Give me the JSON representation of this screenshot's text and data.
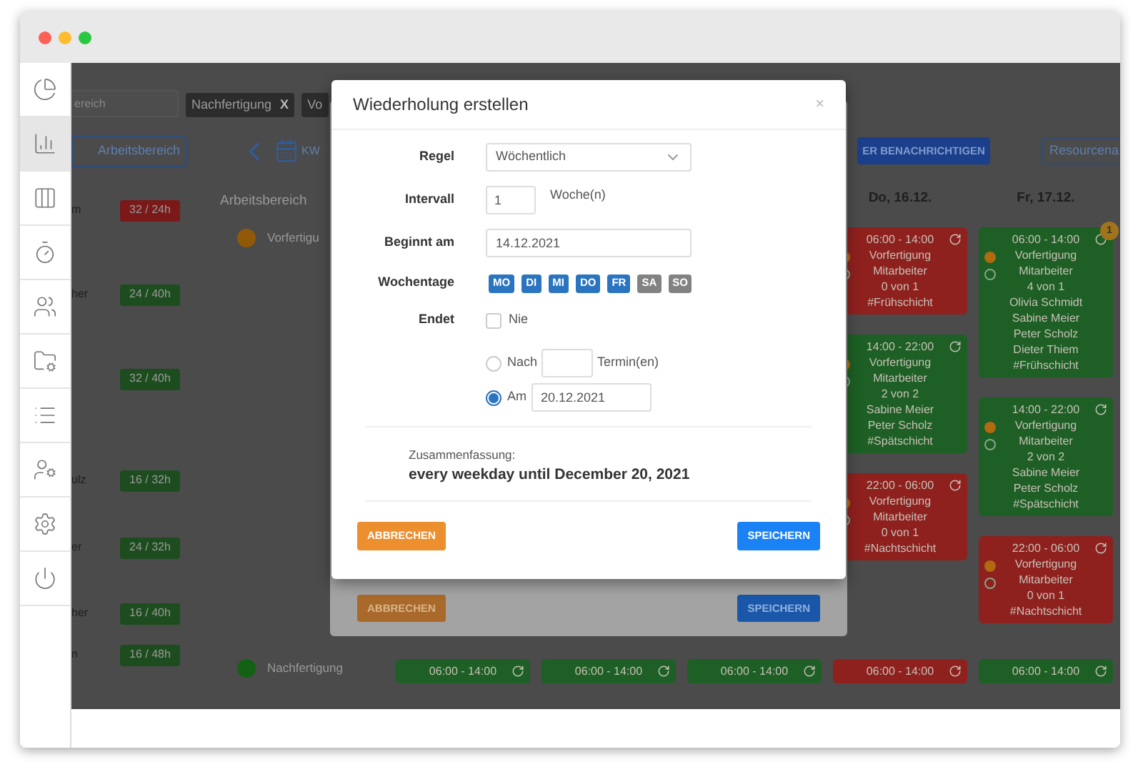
{
  "sidebar": {
    "items": [
      {
        "selected": false
      },
      {
        "selected": true
      },
      {
        "selected": false
      },
      {
        "selected": false
      },
      {
        "selected": false
      },
      {
        "selected": false
      },
      {
        "selected": false
      },
      {
        "selected": false
      },
      {
        "selected": false
      },
      {
        "selected": false
      }
    ]
  },
  "filter": {
    "search": {
      "placeholder": "ereich"
    },
    "tags": [
      {
        "label": "Nachfertigung",
        "remove": "X"
      },
      {
        "label": "Vo"
      }
    ]
  },
  "toolbar": {
    "group_button": "Arbeitsbereich",
    "week": "KW",
    "notify_button": "ER BENACHRICHTIGEN",
    "resource_button": "Resourcena"
  },
  "employees": [
    {
      "name": "m",
      "hours": "32 / 24h",
      "color": "#7b1919"
    },
    {
      "name": "her",
      "hours": "24 / 40h",
      "color": "#1d4d1f"
    },
    {
      "hours": "32 / 40h",
      "color": "#1d4d1f"
    },
    {
      "name": "ulz",
      "hours": "16 / 32h",
      "color": "#1d4d1f"
    },
    {
      "name": "er",
      "hours": "24 / 32h",
      "color": "#1d4d1f"
    },
    {
      "name": "her",
      "hours": "16 / 40h",
      "color": "#1d4d1f"
    },
    {
      "name": "n",
      "hours": "16 / 48h",
      "color": "#1d4d1f"
    }
  ],
  "areas": {
    "header": "Arbeitsbereich",
    "items": [
      {
        "name": "Vorfertigu",
        "color": "#905908"
      },
      {
        "name": "Nachfertigung",
        "color": "#136213"
      }
    ]
  },
  "days": [
    {
      "later_shifts": [
        {
          "lines": [
            "06:00 - 14:00"
          ],
          "color": "#1d5f24"
        }
      ]
    },
    {
      "later_shifts": [
        {
          "lines": [
            "06:00 - 14:00"
          ],
          "color": "#1d5f24"
        }
      ]
    },
    {
      "later_shifts": [
        {
          "lines": [
            "06:00 - 14:00"
          ],
          "color": "#1d5f24"
        }
      ]
    },
    {
      "header": "Do, 16.12.",
      "shifts": [
        {
          "lines": [
            "06:00 - 14:00",
            "Vorfertigung",
            "Mitarbeiter",
            "0 von 1",
            "#Frühschicht"
          ],
          "color": "#8e211e"
        },
        {
          "lines": [
            "14:00 - 22:00",
            "Vorfertigung",
            "Mitarbeiter",
            "2 von 2",
            "Sabine Meier",
            "Peter Scholz",
            "#Spätschicht"
          ],
          "color": "#1d5f24"
        },
        {
          "lines": [
            "22:00 - 06:00",
            "Vorfertigung",
            "Mitarbeiter",
            "0 von 1",
            "#Nachtschicht"
          ],
          "color": "#8e211e"
        }
      ],
      "later_shifts": [
        {
          "lines": [
            "06:00 - 14:00"
          ],
          "color": "#8e211e"
        }
      ]
    },
    {
      "header": "Fr, 17.12.",
      "shifts": [
        {
          "lines": [
            "06:00 - 14:00",
            "Vorfertigung",
            "Mitarbeiter",
            "4 von 1",
            "Olivia Schmidt",
            "Sabine Meier",
            "Peter Scholz",
            "Dieter Thiem",
            "#Frühschicht"
          ],
          "color": "#1d5f24",
          "badge": "1"
        },
        {
          "lines": [
            "14:00 - 22:00",
            "Vorfertigung",
            "Mitarbeiter",
            "2 von 2",
            "Sabine Meier",
            "Peter Scholz",
            "#Spätschicht"
          ],
          "color": "#1d5f24"
        },
        {
          "lines": [
            "22:00 - 06:00",
            "Vorfertigung",
            "Mitarbeiter",
            "0 von 1",
            "#Nachtschicht"
          ],
          "color": "#8e211e"
        }
      ],
      "later_shifts": [
        {
          "lines": [
            "06:00 - 14:00"
          ],
          "color": "#1d5f24"
        }
      ]
    }
  ],
  "back_dialog": {
    "buttons": [
      {
        "label": "ABBRECHEN",
        "kind": "cancel"
      },
      {
        "label": "SPEICHERN",
        "kind": "save"
      }
    ]
  },
  "dialog": {
    "title": "Wiederholung erstellen",
    "close": "×",
    "rule": {
      "label": "Regel",
      "value": "Wöchentlich"
    },
    "interval": {
      "label": "Intervall",
      "value": "1",
      "unit": "Woche(n)"
    },
    "start": {
      "label": "Beginnt am",
      "value": "14.12.2021"
    },
    "weekdays": {
      "label": "Wochentage",
      "days": [
        {
          "label": "MO",
          "selected": true
        },
        {
          "label": "DI",
          "selected": true
        },
        {
          "label": "MI",
          "selected": true
        },
        {
          "label": "DO",
          "selected": true
        },
        {
          "label": "FR",
          "selected": true
        },
        {
          "label": "SA",
          "selected": false
        },
        {
          "label": "SO",
          "selected": false
        }
      ]
    },
    "ends": {
      "label": "Endet",
      "never": {
        "label": "Nie",
        "checked": false
      },
      "options": [
        {
          "kind": "count",
          "label": "Nach",
          "unit": "Termin(en)",
          "selected": false
        },
        {
          "kind": "date",
          "label": "Am",
          "value": "20.12.2021",
          "selected": true
        }
      ]
    },
    "summary": {
      "label": "Zusammenfassung:",
      "text": "every weekday until December 20, 2021"
    },
    "buttons": [
      {
        "label": "ABBRECHEN",
        "kind": "cancel"
      },
      {
        "label": "SPEICHERN",
        "kind": "save"
      }
    ]
  }
}
